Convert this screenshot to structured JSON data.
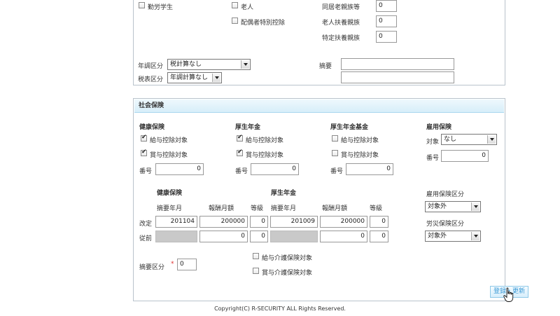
{
  "top_section": {
    "kinro_gakusei": "勤労学生",
    "rojin": "老人",
    "haigusha_tokubetsu": "配偶者特別控除",
    "dokyo_rojin_label": "同居老親族等",
    "dokyo_rojin_value": "0",
    "rojin_fuyo_label": "老人扶養親族",
    "rojin_fuyo_value": "0",
    "tokutei_fuyo_label": "特定扶養親族",
    "tokutei_fuyo_value": "0",
    "nencho_label": "年調区分",
    "nencho_value": "税計算なし",
    "zeihyo_label": "税表区分",
    "zeihyo_value": "年調計算なし",
    "tekiyo_label": "摘要",
    "tekiyo_value1": "",
    "tekiyo_value2": ""
  },
  "insurance": {
    "title": "社会保険",
    "kenko": {
      "title": "健康保険",
      "kyuyo": "給与控除対象",
      "kyuyo_checked": true,
      "shoyo": "賞与控除対象",
      "shoyo_checked": true,
      "bango_label": "番号",
      "bango_value": "0"
    },
    "kosei": {
      "title": "厚生年金",
      "kyuyo": "給与控除対象",
      "kyuyo_checked": true,
      "shoyo": "賞与控除対象",
      "shoyo_checked": true,
      "bango_label": "番号",
      "bango_value": "0"
    },
    "kikin": {
      "title": "厚生年金基金",
      "kyuyo": "給与控除対象",
      "kyuyo_checked": false,
      "shoyo": "賞与控除対象",
      "shoyo_checked": false,
      "bango_label": "番号",
      "bango_value": "0"
    },
    "koyo": {
      "title": "雇用保険",
      "taisho_label": "対象",
      "taisho_value": "なし",
      "bango_label": "番号",
      "bango_value": "0"
    },
    "grid": {
      "kenko_title": "健康保険",
      "kosei_title": "厚生年金",
      "col_month": "摘要年月",
      "col_amount": "報酬月額",
      "col_grade": "等級",
      "row_kaitei": "改定",
      "row_juzen": "従前",
      "kaitei_kenko_month": "201104",
      "kaitei_kenko_amount": "200000",
      "kaitei_kenko_grade": "0",
      "kaitei_kosei_month": "201009",
      "kaitei_kosei_amount": "200000",
      "kaitei_kosei_grade": "0",
      "juzen_kenko_amount": "0",
      "juzen_kenko_grade": "0",
      "juzen_kosei_amount": "0",
      "juzen_kosei_grade": "0"
    },
    "koyo_kubun_label": "雇用保険区分",
    "koyo_kubun_value": "対象外",
    "rosai_kubun_label": "労災保険区分",
    "rosai_kubun_value": "対象外",
    "tekiyo_kubun_label": "摘要区分",
    "tekiyo_kubun_required": "*",
    "tekiyo_kubun_value": "0",
    "kaigo_kyuyo": "給与介護保険対象",
    "kaigo_kyuyo_checked": false,
    "kaigo_shoyo": "賞与介護保険対象",
    "kaigo_shoyo_checked": false
  },
  "button_label": "登録・更新",
  "footer": "Copyright(C) R-SECURITY ALL Rights Reserved."
}
